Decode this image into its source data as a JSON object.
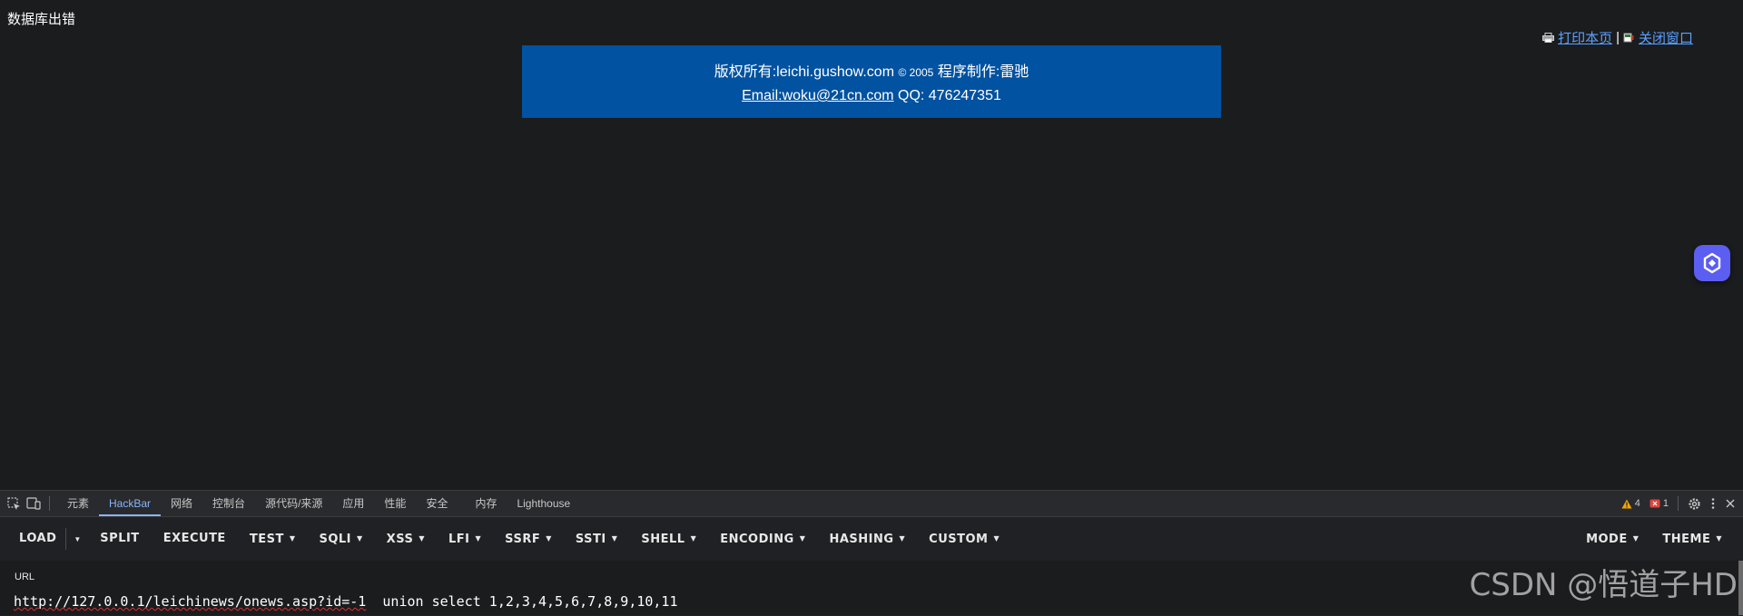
{
  "page": {
    "db_error_text": "数据库出错",
    "print_link": "打印本页",
    "link_separator": "|",
    "close_link": "关闭窗口",
    "copyright_prefix": "版权所有:leichi.gushow.com",
    "copyright_symbol": "© 2005",
    "copyright_suffix": "程序制作:雷驰",
    "email_link": "Email:woku@21cn.com",
    "qq": "QQ: 476247351"
  },
  "devtools": {
    "tabs": [
      {
        "label": "元素"
      },
      {
        "label": "HackBar"
      },
      {
        "label": "网络"
      },
      {
        "label": "控制台"
      },
      {
        "label": "源代码/来源"
      },
      {
        "label": "应用"
      },
      {
        "label": "性能"
      },
      {
        "label": "安全"
      },
      {
        "label": "内存"
      },
      {
        "label": "Lighthouse"
      }
    ],
    "warnings_count": "4",
    "errors_count": "1",
    "colors": {
      "warning": "#f2a600",
      "error": "#e0443e",
      "active_tab": "#8ab4f8"
    }
  },
  "hackbar": {
    "buttons": [
      "LOAD",
      "SPLIT",
      "EXECUTE",
      "TEST",
      "SQLI",
      "XSS",
      "LFI",
      "SSRF",
      "SSTI",
      "SHELL",
      "ENCODING",
      "HASHING",
      "CUSTOM"
    ],
    "right_buttons": [
      "MODE",
      "THEME"
    ],
    "url_label": "URL",
    "url_value_main": "http://127.0.0.1/leichinews/onews.asp?id=-1",
    "url_value_rest": "  union select 1,2,3,4,5,6,7,8,9,10,11"
  },
  "watermark": "CSDN @悟道子HD"
}
